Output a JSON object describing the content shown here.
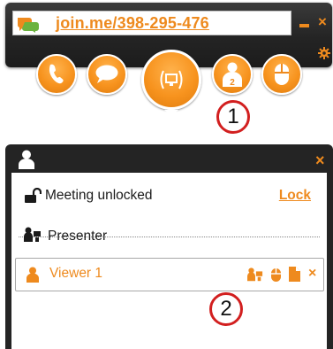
{
  "toolbar": {
    "url": "join.me/398-295-476",
    "buttons": [
      "phone-icon",
      "chat-icon",
      "screen-share-icon",
      "participants-icon",
      "mouse-icon"
    ],
    "participant_count": "2"
  },
  "callouts": {
    "first": "1",
    "second": "2"
  },
  "panel": {
    "meeting_status": "Meeting unlocked",
    "lock_label": "Lock",
    "presenter_label": "Presenter",
    "viewer_name": "Viewer 1"
  },
  "colors": {
    "accent": "#ee8a1e",
    "dark": "#242424"
  }
}
